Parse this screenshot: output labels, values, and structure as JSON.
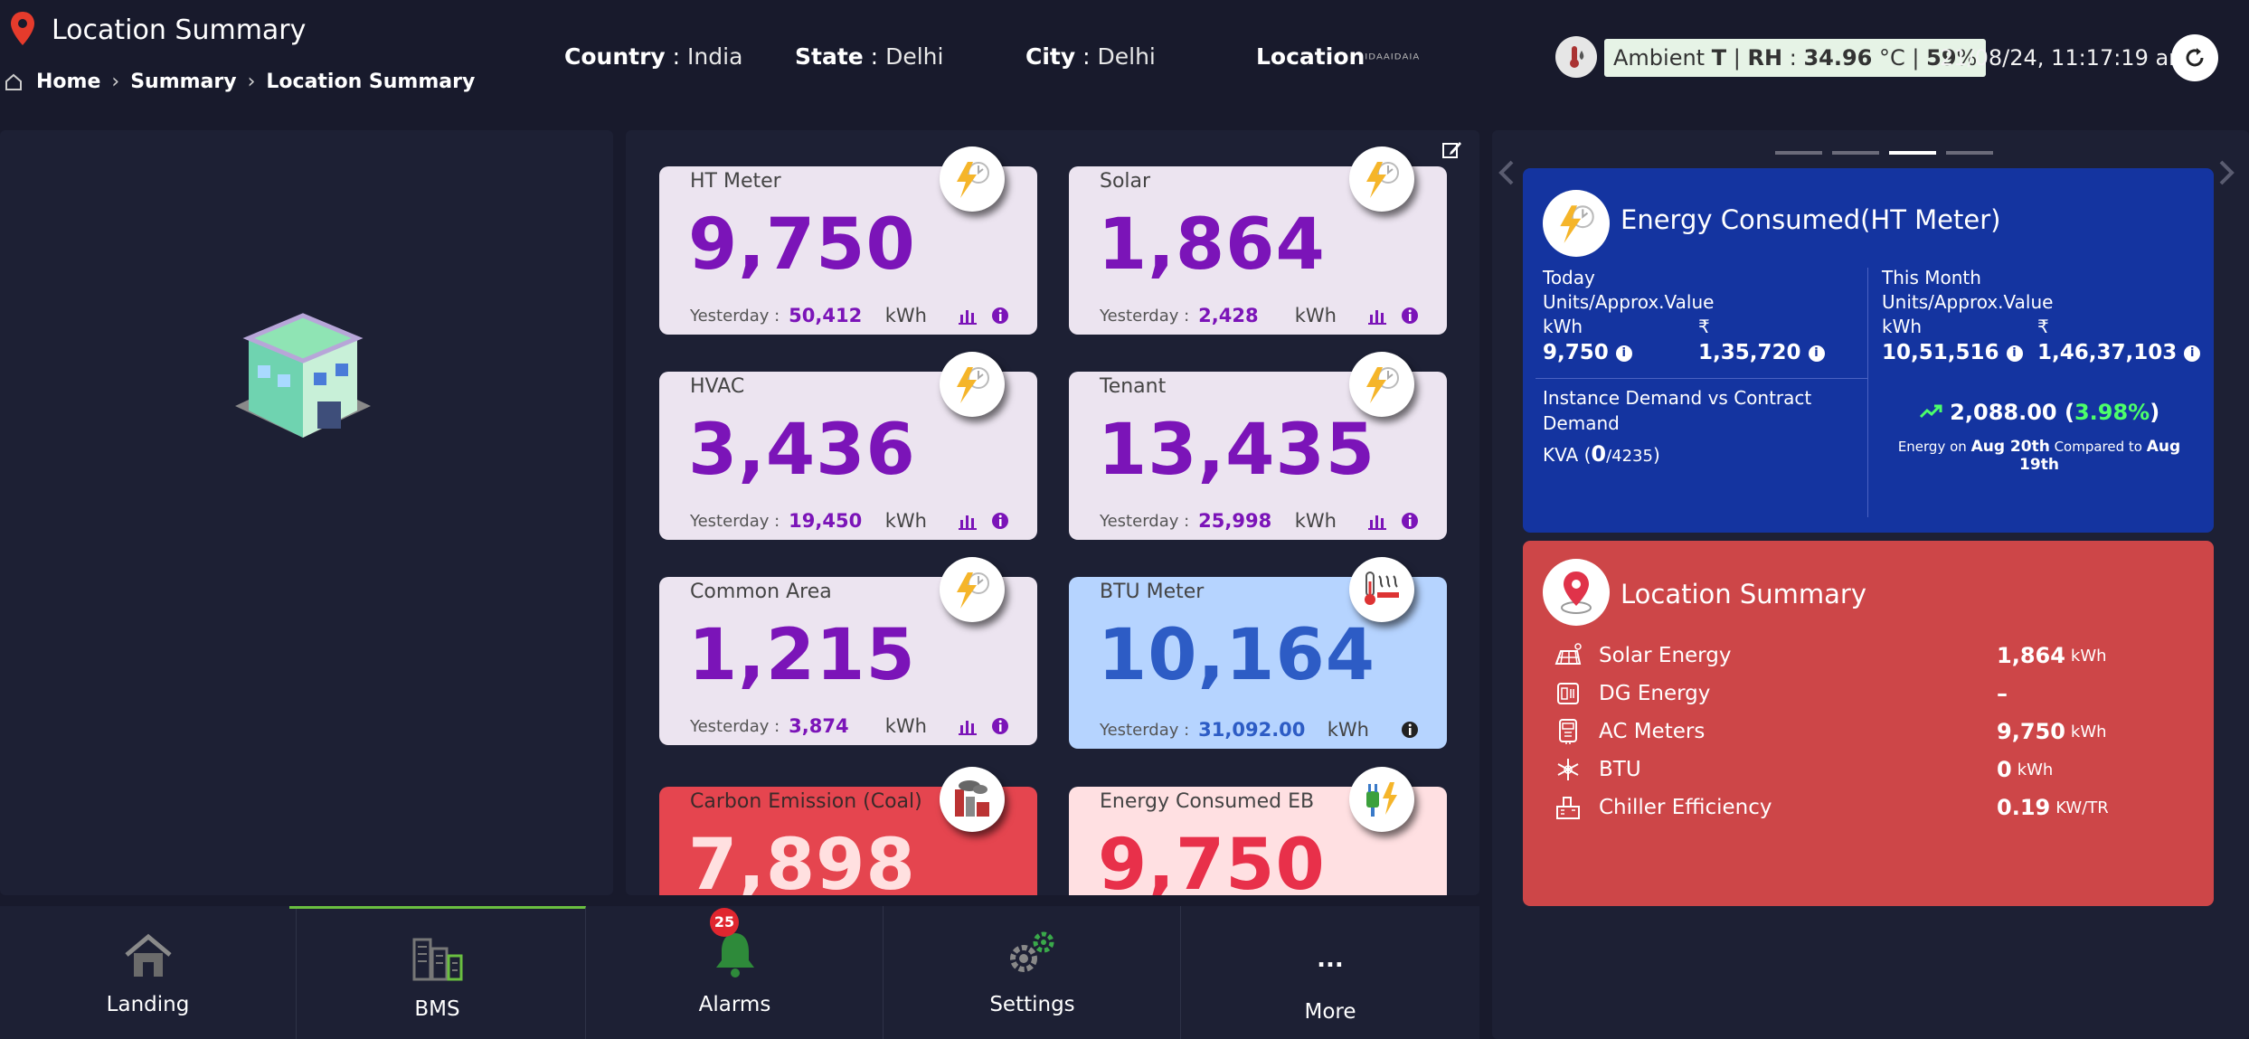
{
  "header": {
    "title": "Location Summary",
    "breadcrumb": [
      "Home",
      "Summary",
      "Location Summary"
    ],
    "country_label": "Country",
    "country_value": "India",
    "state_label": "State",
    "state_value": "Delhi",
    "city_label": "City",
    "city_value": "Delhi",
    "location_label": "Location",
    "location_value": "ᴵᴰᴬᴬᴵᴰᴬᴵᴬ",
    "ambient_prefix": "Ambient",
    "ambient_t": "T",
    "ambient_sep": "|",
    "ambient_rh": "RH",
    "ambient_colon": ":",
    "ambient_temp": "34.96",
    "ambient_temp_unit": "°C",
    "ambient_slash": "|",
    "ambient_humidity": "59",
    "ambient_humidity_unit": "%",
    "datetime": "21/08/24, 11:17:19 am"
  },
  "meters": [
    {
      "label": "HT Meter",
      "value": "9,750",
      "yesterday_label": "Yesterday :",
      "yesterday": "50,412",
      "unit": "kWh"
    },
    {
      "label": "Solar",
      "value": "1,864",
      "yesterday_label": "Yesterday :",
      "yesterday": "2,428",
      "unit": "kWh"
    },
    {
      "label": "HVAC",
      "value": "3,436",
      "yesterday_label": "Yesterday :",
      "yesterday": "19,450",
      "unit": "kWh"
    },
    {
      "label": "Tenant",
      "value": "13,435",
      "yesterday_label": "Yesterday :",
      "yesterday": "25,998",
      "unit": "kWh"
    },
    {
      "label": "Common Area",
      "value": "1,215",
      "yesterday_label": "Yesterday :",
      "yesterday": "3,874",
      "unit": "kWh"
    },
    {
      "label": "BTU Meter",
      "value": "10,164",
      "yesterday_label": "Yesterday :",
      "yesterday": "31,092.00",
      "unit": "kWh"
    },
    {
      "label": "Carbon Emission (Coal)",
      "value": "7,898"
    },
    {
      "label": "Energy Consumed EB",
      "value": "9,750"
    }
  ],
  "energy": {
    "title": "Energy Consumed(HT Meter)",
    "today_label": "Today",
    "month_label": "This Month",
    "units_label": "Units/Approx.Value",
    "kwh_label": "kWh",
    "rupee": "₹",
    "today_kwh": "9,750",
    "today_value": "1,35,720",
    "month_kwh": "10,51,516",
    "month_value": "1,46,37,103",
    "demand_label": "Instance Demand vs Contract Demand",
    "kva_label": "KVA",
    "kva_open": "(",
    "kva_current": "0",
    "kva_contract": "/4235",
    "kva_close": ")",
    "compare_value": "2,088.00",
    "compare_pct": "3.98%",
    "compare_open": "(",
    "compare_close": ")",
    "compare_text_1": "Energy on",
    "compare_date_1": "Aug 20th",
    "compare_text_2": "Compared to",
    "compare_date_2": "Aug 19th"
  },
  "location_summary": {
    "title": "Location Summary",
    "rows": [
      {
        "name": "Solar Energy",
        "value": "1,864",
        "unit": "kWh"
      },
      {
        "name": "DG Energy",
        "value": "–",
        "unit": ""
      },
      {
        "name": "AC Meters",
        "value": "9,750",
        "unit": "kWh"
      },
      {
        "name": "BTU",
        "value": "0",
        "unit": "kWh"
      },
      {
        "name": "Chiller Efficiency",
        "value": "0.19",
        "unit": "KW/TR"
      }
    ]
  },
  "nav": {
    "items": [
      "Landing",
      "BMS",
      "Alarms",
      "Settings",
      "More"
    ],
    "alarm_count": "25",
    "more_dots": "..."
  },
  "colors": {
    "background": "#181a2c",
    "panel": "#1d2034",
    "meter_value_purple": "#7b14b8",
    "energy_blue": "#1434a0",
    "summary_red": "#cd4648",
    "active_tab": "#6abf40"
  }
}
